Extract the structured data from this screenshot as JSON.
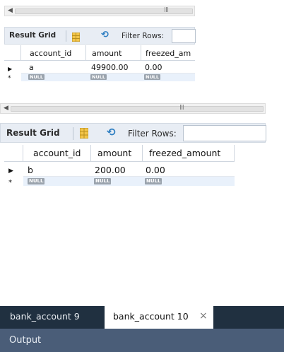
{
  "panels": [
    {
      "scroll_grip": "III",
      "toolbar": {
        "result_grid_label": "Result Grid",
        "filter_label": "Filter Rows:"
      },
      "columns": [
        "account_id",
        "amount",
        "freezed_am"
      ],
      "rows": [
        {
          "account_id": "a",
          "amount": "49900.00",
          "freezed_amount": "0.00"
        }
      ],
      "null_label": "NULL"
    },
    {
      "scroll_grip": "III",
      "toolbar": {
        "result_grid_label": "Result Grid",
        "filter_label": "Filter Rows:"
      },
      "columns": [
        "account_id",
        "amount",
        "freezed_amount"
      ],
      "rows": [
        {
          "account_id": "b",
          "amount": "200.00",
          "freezed_amount": "0.00"
        }
      ],
      "null_label": "NULL"
    }
  ],
  "tabs": [
    {
      "label": "bank_account 9",
      "active": false
    },
    {
      "label": "bank_account 10",
      "active": true,
      "close": "×"
    }
  ],
  "output_label": "Output",
  "colors": {
    "tab_bar": "#203040",
    "output_bar": "#4a5d78",
    "toolbar_bg": "#e8edf4",
    "null_row": "#e9f1fb",
    "filter_icon": "#2f7fc2"
  }
}
